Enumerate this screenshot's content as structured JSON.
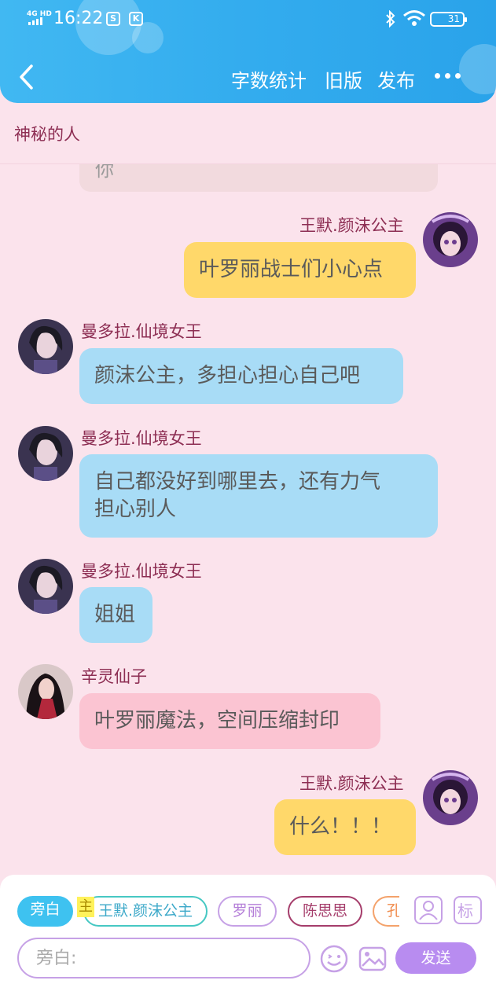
{
  "status_bar": {
    "network": "4G HD",
    "time": "16:22",
    "app_icons": [
      "S",
      "K"
    ],
    "battery": "31"
  },
  "nav": {
    "actions": [
      "字数统计",
      "旧版",
      "发布"
    ]
  },
  "story_title": "神秘的人",
  "partial_message": "你",
  "messages": [
    {
      "side": "right",
      "speaker": "王默.颜沫公主",
      "text": "叶罗丽战士们小心点",
      "color": "#ffd86a"
    },
    {
      "side": "left",
      "speaker": "曼多拉.仙境女王",
      "text": "颜沫公主，多担心担心自己吧",
      "color": "#a8dcf6"
    },
    {
      "side": "left",
      "speaker": "曼多拉.仙境女王",
      "text_lines": [
        "自己都没好到哪里去，还有力气",
        "担心别人"
      ],
      "color": "#a8dcf6"
    },
    {
      "side": "left",
      "speaker": "曼多拉.仙境女王",
      "text": "姐姐",
      "color": "#a8dcf6"
    },
    {
      "side": "left",
      "speaker": "辛灵仙子",
      "text": "叶罗丽魔法，空间压缩封印",
      "color": "#fbc4d2"
    },
    {
      "side": "right",
      "speaker": "王默.颜沫公主",
      "text": "什么！！！",
      "color": "#ffd86a"
    }
  ],
  "composer": {
    "main_tag": "主",
    "characters": [
      "旁白",
      "王默.颜沫公主",
      "罗丽",
      "陈思思",
      "孔"
    ],
    "input_placeholder": "旁白:",
    "send_label": "发送"
  },
  "colors": {
    "header_blue": "#33acee",
    "background_pink": "#fbe3ec",
    "name_maroon": "#8d2e53",
    "send_purple": "#b88cf0"
  }
}
